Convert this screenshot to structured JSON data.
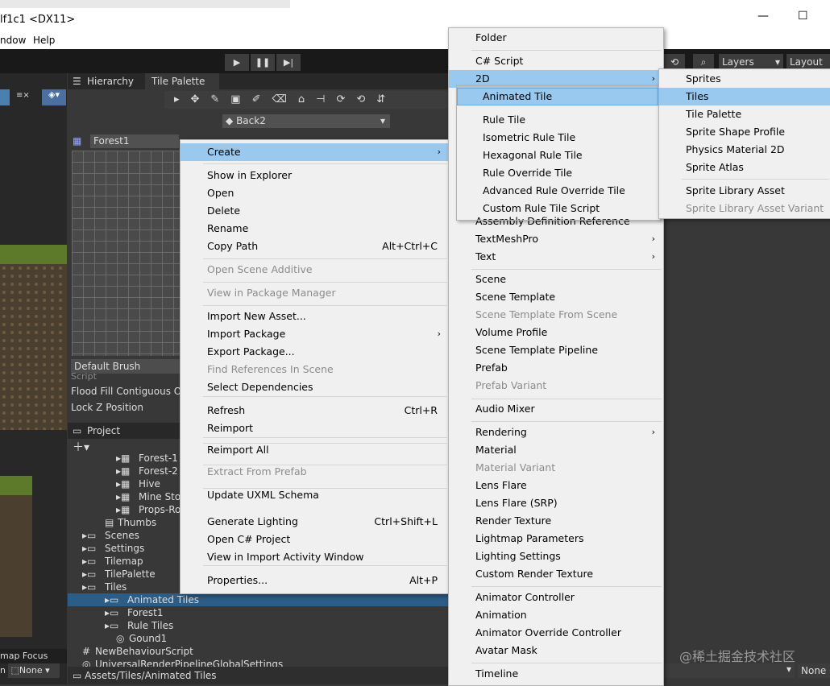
{
  "window": {
    "title": "lf1c1  <DX11>",
    "minimize": "—",
    "maximize": "☐"
  },
  "menubar": {
    "items": [
      "ndow",
      "Help"
    ]
  },
  "toolbar": {
    "layers": "Layers",
    "layout": "Layout"
  },
  "tabs": {
    "hierarchy": "Hierarchy",
    "tile_palette": "Tile Palette"
  },
  "palette": {
    "active_layer": "Back2",
    "palette_name": "Forest1",
    "brush": "Default Brush",
    "script_label": "Script",
    "flood_fill": "Flood Fill Contiguous On",
    "lock_z": "Lock Z Position"
  },
  "project": {
    "tab": "Project",
    "tree": [
      {
        "label": "Forest-1",
        "indent": 1
      },
      {
        "label": "Forest-2",
        "indent": 1
      },
      {
        "label": "Hive",
        "indent": 1
      },
      {
        "label": "Mine Sto",
        "indent": 1
      },
      {
        "label": "Props-Ro",
        "indent": 1
      },
      {
        "label": "Thumbs",
        "indent": 0
      },
      {
        "label": "Scenes",
        "indent": -1
      },
      {
        "label": "Settings",
        "indent": -1
      },
      {
        "label": "Tilemap",
        "indent": -1
      },
      {
        "label": "TilePalette",
        "indent": -1
      },
      {
        "label": "Tiles",
        "indent": -1
      },
      {
        "label": "Animated Tiles",
        "indent": 0
      },
      {
        "label": "Forest1",
        "indent": 0
      },
      {
        "label": "Rule Tiles",
        "indent": 0
      },
      {
        "label": "Gound1",
        "indent": 1
      },
      {
        "label": "NewBehaviourScript",
        "indent": -1
      },
      {
        "label": "UniversalRenderPipelineGlobalSettings",
        "indent": -1
      }
    ],
    "path": "Assets/Tiles/Animated Tiles"
  },
  "scene_bottom": {
    "focus": "map Focus",
    "n": "n",
    "none": "None",
    "none_right": "None"
  },
  "context_menu": [
    {
      "label": "Create",
      "arrow": "›",
      "hl": true
    },
    {
      "sep": true
    },
    {
      "label": "Show in Explorer"
    },
    {
      "label": "Open"
    },
    {
      "label": "Delete"
    },
    {
      "label": "Rename"
    },
    {
      "label": "Copy Path",
      "shortcut": "Alt+Ctrl+C"
    },
    {
      "sep": true
    },
    {
      "label": "Open Scene Additive",
      "disabled": true
    },
    {
      "sep": true
    },
    {
      "label": "View in Package Manager",
      "disabled": true
    },
    {
      "sep": true
    },
    {
      "label": "Import New Asset..."
    },
    {
      "label": "Import Package",
      "arrow": "›"
    },
    {
      "label": "Export Package..."
    },
    {
      "label": "Find References In Scene",
      "disabled": true
    },
    {
      "label": "Select Dependencies"
    },
    {
      "sep": true
    },
    {
      "label": "Refresh",
      "shortcut": "Ctrl+R"
    },
    {
      "label": "Reimport"
    },
    {
      "sep": true
    },
    {
      "label": "Reimport All"
    },
    {
      "sep": true
    },
    {
      "label": "Extract From Prefab",
      "disabled": true
    },
    {
      "sep": true
    },
    {
      "label": "Update UXML Schema"
    },
    {
      "sep": true
    },
    {
      "label": "Generate Lighting",
      "shortcut": "Ctrl+Shift+L"
    },
    {
      "label": "Open C# Project"
    },
    {
      "label": "View in Import Activity Window"
    },
    {
      "sep": true
    },
    {
      "label": "Properties...",
      "shortcut": "Alt+P"
    }
  ],
  "create_menu": [
    {
      "label": "Folder"
    },
    {
      "sep": true
    },
    {
      "label": "C# Script"
    },
    {
      "label": "2D",
      "arrow": "›",
      "hl": true
    },
    {
      "label": "Animated Tile"
    },
    {
      "label": "Rule Tile"
    },
    {
      "label": "Isometric Rule Tile"
    },
    {
      "label": "Hexagonal Rule Tile"
    },
    {
      "label": "Rule Override Tile"
    },
    {
      "label": "Advanced Rule Override Tile"
    },
    {
      "label": "Custom Rule Tile Script"
    },
    {
      "label": "Assembly Definition Reference"
    },
    {
      "label": "TextMeshPro",
      "arrow": "›"
    },
    {
      "label": "Text",
      "arrow": "›"
    },
    {
      "sep": true
    },
    {
      "label": "Scene"
    },
    {
      "label": "Scene Template"
    },
    {
      "label": "Scene Template From Scene",
      "disabled": true
    },
    {
      "label": "Volume Profile"
    },
    {
      "label": "Scene Template Pipeline"
    },
    {
      "label": "Prefab"
    },
    {
      "label": "Prefab Variant",
      "disabled": true
    },
    {
      "sep": true
    },
    {
      "label": "Audio Mixer"
    },
    {
      "sep": true
    },
    {
      "label": "Rendering",
      "arrow": "›"
    },
    {
      "label": "Material"
    },
    {
      "label": "Material Variant",
      "disabled": true
    },
    {
      "label": "Lens Flare"
    },
    {
      "label": "Lens Flare (SRP)"
    },
    {
      "label": "Render Texture"
    },
    {
      "label": "Lightmap Parameters"
    },
    {
      "label": "Lighting Settings"
    },
    {
      "label": "Custom Render Texture"
    },
    {
      "sep": true
    },
    {
      "label": "Animator Controller"
    },
    {
      "label": "Animation"
    },
    {
      "label": "Animator Override Controller"
    },
    {
      "label": "Avatar Mask"
    },
    {
      "sep": true
    },
    {
      "label": "Timeline"
    }
  ],
  "sub_2d_menu": [
    {
      "label": "Sprites"
    },
    {
      "label": "Tiles",
      "hl": true
    },
    {
      "label": "Tile Palette"
    },
    {
      "label": "Sprite Shape Profile"
    },
    {
      "label": "Physics Material 2D"
    },
    {
      "label": "Sprite Atlas"
    },
    {
      "sep": true
    },
    {
      "label": "Sprite Library Asset"
    },
    {
      "label": "Sprite Library Asset Variant",
      "disabled": true
    }
  ],
  "watermark": "@稀土掘金技术社区",
  "colors": {
    "highlight": "#99c9ef",
    "selection": "#2c5d87",
    "menu_bg": "#f0f0f0"
  }
}
